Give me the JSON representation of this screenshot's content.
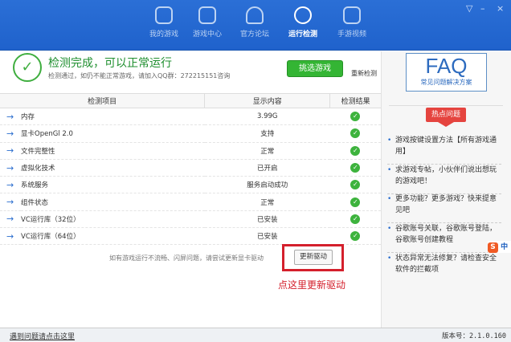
{
  "nav": {
    "tabs": [
      "我的游戏",
      "游戏中心",
      "官方论坛",
      "运行检测",
      "手游视频"
    ],
    "active": 3
  },
  "window": {
    "menu": "▽",
    "minimize": "–",
    "close": "×"
  },
  "status": {
    "icon": "✓",
    "title": "检测完成，可以正常运行",
    "subtitle": "检测通过，如仍不能正常游戏，请加入QQ群：272215151咨询",
    "pick_label": "挑选游戏",
    "retest_label": "重新检测"
  },
  "table": {
    "headers": [
      "检测项目",
      "显示内容",
      "检测结果"
    ],
    "rows": [
      {
        "item": "内存",
        "value": "3.99G"
      },
      {
        "item": "显卡OpenGl 2.0",
        "value": "支持"
      },
      {
        "item": "文件完整性",
        "value": "正常"
      },
      {
        "item": "虚拟化技术",
        "value": "已开启"
      },
      {
        "item": "系统服务",
        "value": "服务启动成功"
      },
      {
        "item": "组件状态",
        "value": "正常"
      },
      {
        "item": "VC运行库（32位）",
        "value": "已安装"
      },
      {
        "item": "VC运行库（64位）",
        "value": "已安装"
      }
    ],
    "ok_icon": "✓"
  },
  "driver": {
    "hint": "如有游戏运行不流畅、闪屏问题，请尝试更新显卡驱动",
    "button": "更新驱动",
    "annotation": "点这里更新驱动"
  },
  "faq": {
    "title": "FAQ",
    "subtitle": "常见问题解决方案",
    "hot_label": "热点问题",
    "items": [
      "游戏按键设置方法【所有游戏通用】",
      "求游戏专帖，小伙伴们说出想玩的游戏吧！",
      "更多功能？更多游戏？快来提意见吧",
      "谷歌账号关联，谷歌账号登陆，谷歌账号创建教程",
      "状态异常无法修复？请检查安全软件的拦截项"
    ]
  },
  "ime": {
    "logo": "S",
    "mode": "中"
  },
  "footer": {
    "link": "遇到问题请点击这里",
    "version": "版本号：2.1.0.160"
  }
}
